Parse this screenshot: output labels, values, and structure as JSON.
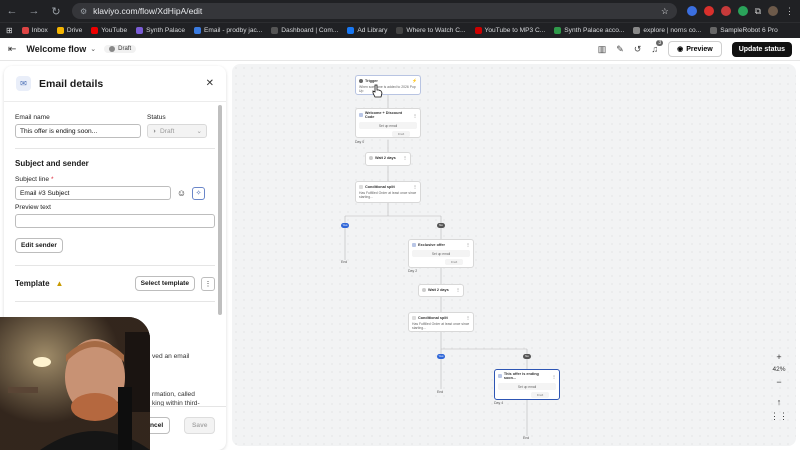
{
  "browser": {
    "url": "klaviyo.com/flow/XdHipA/edit",
    "bookmarks": [
      "Inbox",
      "Drive",
      "YouTube",
      "Synth Palace",
      "Email - prodby jac...",
      "Dashboard | Com...",
      "Ad Library",
      "Where to Watch C...",
      "YouTube to MP3 C...",
      "Synth Palace acco...",
      "explore | norns co...",
      "SampleRobot 6 Pro"
    ]
  },
  "header": {
    "flow_title": "Welcome flow",
    "status": "Draft",
    "notification_count": "3",
    "preview_label": "Preview",
    "update_label": "Update status"
  },
  "panel": {
    "title": "Email details",
    "email_name_label": "Email name",
    "email_name_value": "This offer is ending soon...",
    "status_label": "Status",
    "status_value": "Draft",
    "subject_section": "Subject and sender",
    "subject_label": "Subject line",
    "subject_value": "Email #3 Subject",
    "preview_text_label": "Preview text",
    "edit_sender": "Edit sender",
    "template_section": "Template",
    "select_template": "Select template",
    "frag1": "ved an email",
    "frag2": "rmation, called",
    "frag3": "king within third-",
    "cancel": "ncel",
    "save": "Save"
  },
  "canvas": {
    "trigger_title": "Trigger",
    "trigger_text": "When someone is added to 2026 Pop Up",
    "welcome_title": "Welcome + Discount Code",
    "setup_email": "Set up email",
    "draft": "Draft",
    "day0": "Day 0",
    "wait2": "Wait 2 days",
    "cond_split": "Conditional split",
    "cond_text1": "Has Fulfilled Order at least once since starting...",
    "yes": "Yes",
    "no": "No",
    "exclusive_title": "Exclusive offer",
    "day2": "Day 2",
    "wait2b": "Wait 2 days",
    "cond_split2": "Conditional split",
    "cond_text2": "Has Fulfilled Order at least once since starting...",
    "ending_title": "This offer is ending soon...",
    "day4": "Day 4",
    "end": "End"
  },
  "zoom": {
    "level": "42%"
  }
}
